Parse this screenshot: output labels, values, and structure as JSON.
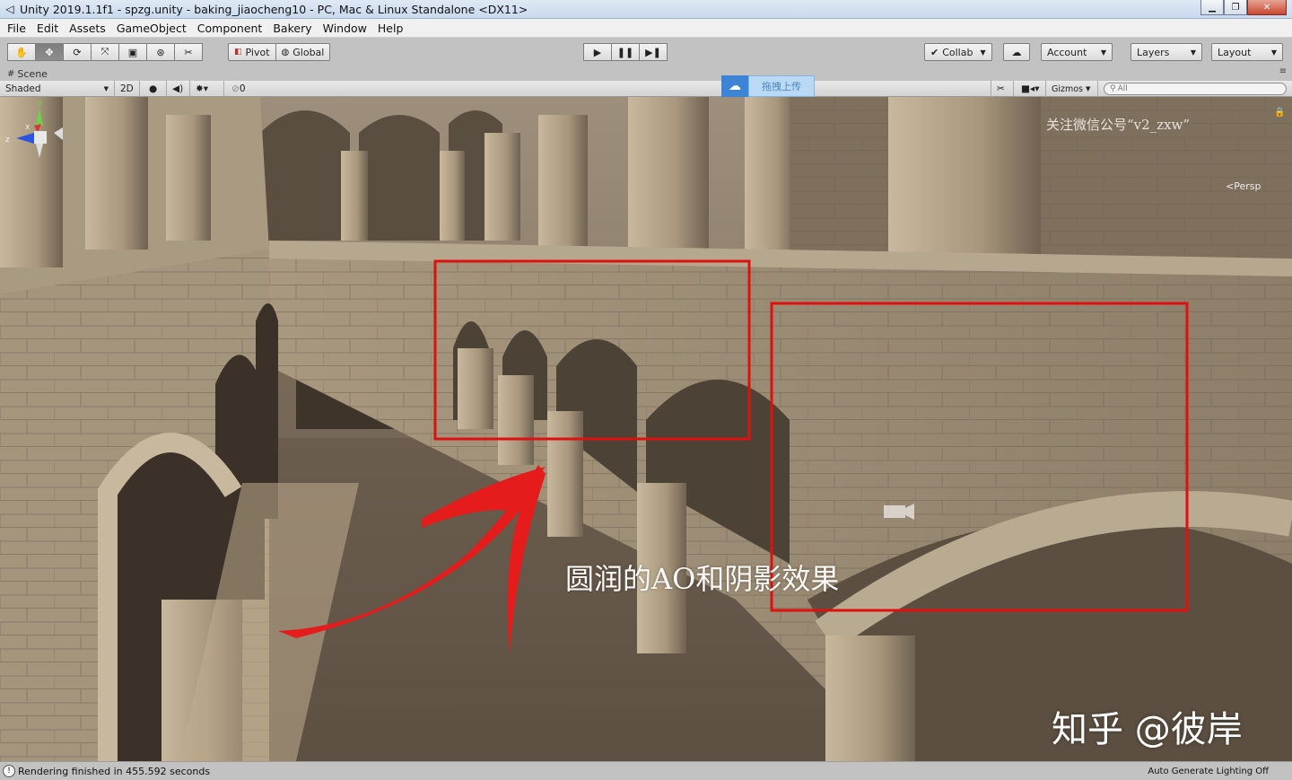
{
  "window": {
    "title": "Unity 2019.1.1f1 - spzg.unity - baking_jiaocheng10 - PC, Mac & Linux Standalone <DX11>"
  },
  "menu": [
    "File",
    "Edit",
    "Assets",
    "GameObject",
    "Component",
    "Bakery",
    "Window",
    "Help"
  ],
  "toolbar": {
    "pivot_label": "Pivot",
    "global_label": "Global",
    "collab_label": "Collab",
    "account_label": "Account",
    "layers_label": "Layers",
    "layout_label": "Layout"
  },
  "scene_tab": {
    "label": "Scene"
  },
  "scene_toolbar": {
    "shading_mode": "Shaded",
    "mode_2d": "2D",
    "hidden_count": "0",
    "gizmos_label": "Gizmos",
    "search_placeholder": "All"
  },
  "upload_button": {
    "label": "拖拽上传"
  },
  "scene": {
    "watermark": "关注微信公号“v2_zxw”",
    "caption": "圆润的AO和阴影效果",
    "signature": "知乎 @彼岸",
    "projection": "Persp",
    "gizmo_axes": [
      "y",
      "x",
      "z"
    ]
  },
  "status": {
    "message": "Rendering finished in 455.592 seconds",
    "right_text": "Auto Generate Lighting Off"
  },
  "colors": {
    "annotation_red": "#e01010",
    "upload_blue": "#3e84d6",
    "stone": "#a79680"
  }
}
